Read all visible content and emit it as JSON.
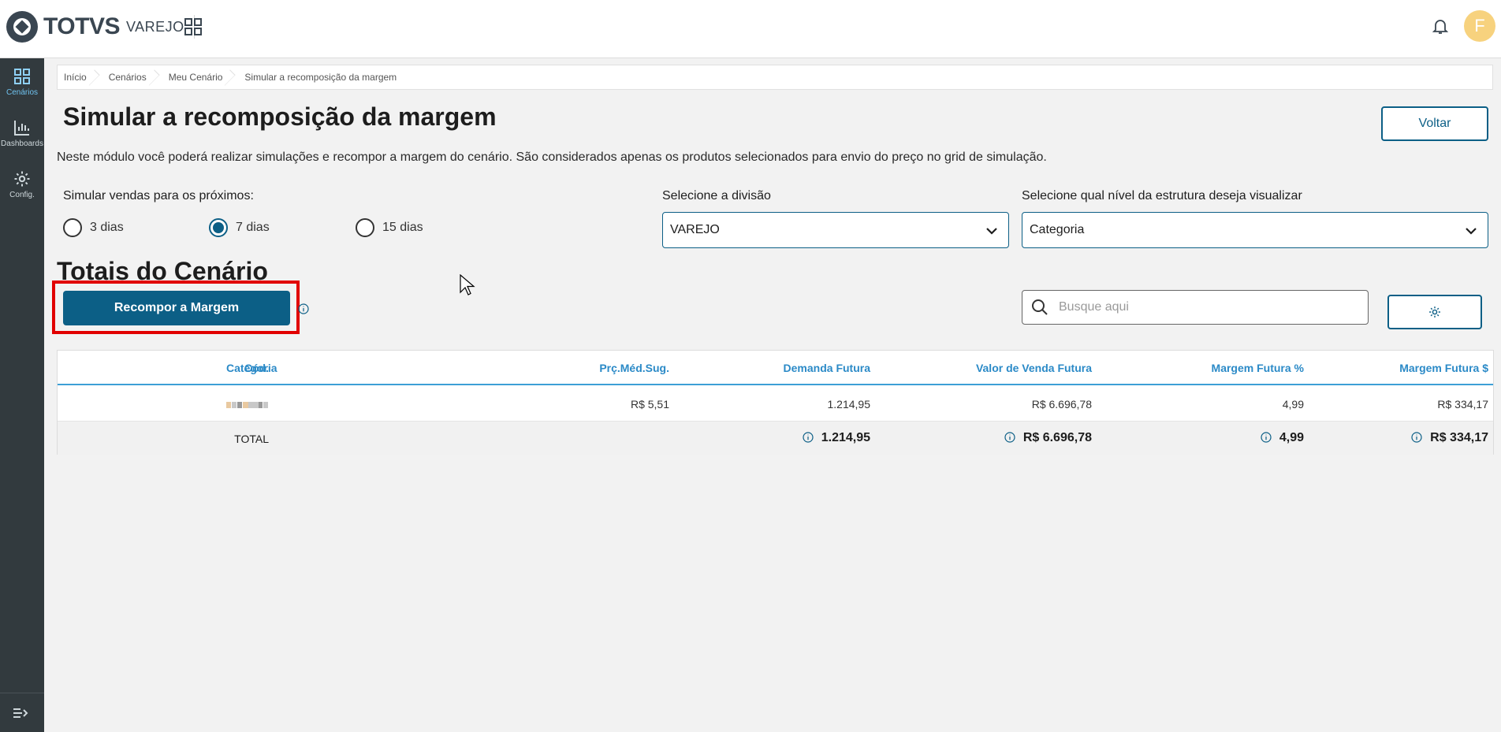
{
  "header": {
    "logo_text": "TOTVS",
    "logo_sub": "VAREJO",
    "avatar_initial": "F"
  },
  "sidebar": {
    "items": [
      {
        "label": "Cenários",
        "icon": "grid-icon",
        "active": true
      },
      {
        "label": "Dashboards",
        "icon": "bar-chart-icon",
        "active": false
      },
      {
        "label": "Config.",
        "icon": "gear-icon",
        "active": false
      }
    ]
  },
  "breadcrumb": [
    "Início",
    "Cenários",
    "Meu Cenário",
    "Simular a recomposição da margem"
  ],
  "page": {
    "title": "Simular a recomposição da margem",
    "back_label": "Voltar",
    "description": "Neste módulo você poderá realizar simulações e recompor a margem do cenário. São considerados apenas os produtos selecionados para envio do preço no grid de simulação."
  },
  "simulation": {
    "label": "Simular vendas para os próximos:",
    "options": [
      "3 dias",
      "7 dias",
      "15 dias"
    ],
    "selected": "7 dias"
  },
  "division": {
    "label": "Selecione a divisão",
    "value": "VAREJO"
  },
  "structure": {
    "label": "Selecione qual nível da estrutura deseja visualizar",
    "value": "Categoria"
  },
  "totals": {
    "title": "Totais do Cenário",
    "recompose_label": "Recompor a Margem",
    "search_placeholder": "Busque aqui"
  },
  "table": {
    "columns": [
      "Cód.",
      "Categoria",
      "Prç.Méd.Sug.",
      "Demanda Futura",
      "Valor de Venda Futura",
      "Margem Futura %",
      "Margem Futura $"
    ],
    "rows": [
      {
        "preco": "R$ 5,51",
        "demanda": "1.214,95",
        "valor": "R$ 6.696,78",
        "margem_pct": "4,99",
        "margem_val": "R$ 334,17"
      }
    ],
    "total": {
      "label": "TOTAL",
      "demanda": "1.214,95",
      "valor": "R$ 6.696,78",
      "margem_pct": "4,99",
      "margem_val": "R$ 334,17"
    }
  },
  "colors": {
    "accent": "#0c5f86",
    "header_link": "#2b8ac7",
    "highlight": "#e10000",
    "sidebar": "#323a3e"
  }
}
